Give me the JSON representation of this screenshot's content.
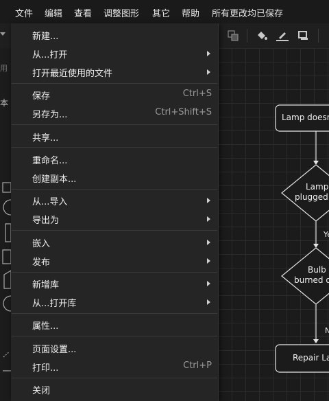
{
  "menubar": {
    "file": "文件",
    "edit": "编辑",
    "view": "查看",
    "arrange": "调整图形",
    "extras": "其它",
    "help": "帮助",
    "status": "所有更改均已保存"
  },
  "sidebar": {
    "frag_1": "用",
    "frag_2": "本"
  },
  "file_menu": {
    "new": "新建...",
    "open_from": "从...打开",
    "open_recent": "打开最近使用的文件",
    "save": "保存",
    "save_shortcut": "Ctrl+S",
    "save_as": "另存为...",
    "save_as_shortcut": "Ctrl+Shift+S",
    "share": "共享...",
    "rename": "重命名...",
    "make_copy": "创建副本...",
    "import_from": "从...导入",
    "export_as": "导出为",
    "embed": "嵌入",
    "publish": "发布",
    "new_library": "新增库",
    "open_library_from": "从...打开库",
    "properties": "属性...",
    "page_setup": "页面设置...",
    "print": "打印...",
    "print_shortcut": "Ctrl+P",
    "close": "关闭"
  },
  "diagram": {
    "start": "Lamp doesn't work",
    "q1_line1": "Lamp",
    "q1_line2": "plugged in?",
    "yes": "Yes",
    "q2_line1": "Bulb",
    "q2_line2": "burned out?",
    "no": "No",
    "action": "Repair Lamp"
  }
}
